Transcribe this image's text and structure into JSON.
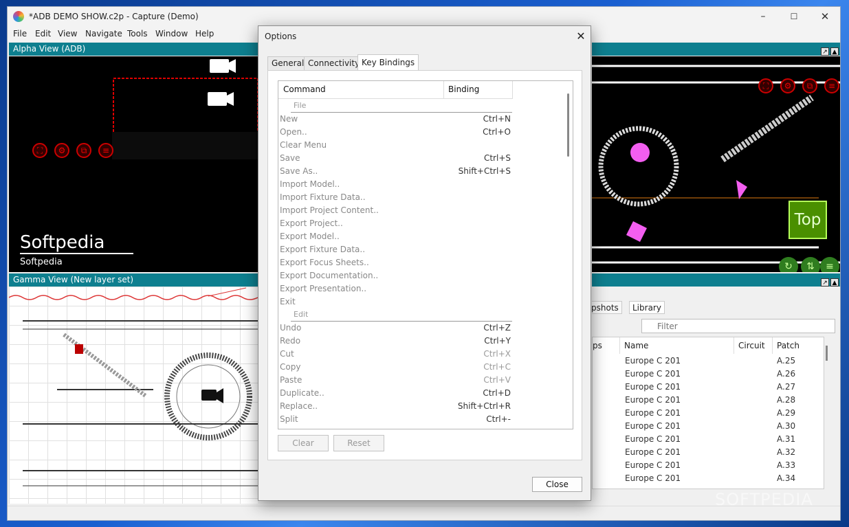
{
  "window": {
    "title": "*ADB DEMO SHOW.c2p - Capture (Demo)",
    "min": "–",
    "max": "☐",
    "close": "✕"
  },
  "menu": [
    "File",
    "Edit",
    "View",
    "Navigate",
    "Tools",
    "Window",
    "Help"
  ],
  "panels": {
    "alpha": {
      "title": "Alpha View  (ADB)",
      "caption_big": "Softpedia",
      "caption_small": "Softpedia"
    },
    "gamma": {
      "title": "Gamma View  (New layer set)"
    },
    "top": {
      "label": "Top"
    }
  },
  "library": {
    "tabs": [
      "pshots",
      "Library"
    ],
    "filter_placeholder": "Filter",
    "columns": [
      "ps",
      "Name",
      "Circuit",
      "Patch"
    ],
    "rows": [
      {
        "name": "Europe C 201",
        "patch": "A.25"
      },
      {
        "name": "Europe C 201",
        "patch": "A.26"
      },
      {
        "name": "Europe C 201",
        "patch": "A.27"
      },
      {
        "name": "Europe C 201",
        "patch": "A.28"
      },
      {
        "name": "Europe C 201",
        "patch": "A.29"
      },
      {
        "name": "Europe C 201",
        "patch": "A.30"
      },
      {
        "name": "Europe C 201",
        "patch": "A.31"
      },
      {
        "name": "Europe C 201",
        "patch": "A.32"
      },
      {
        "name": "Europe C 201",
        "patch": "A.33"
      },
      {
        "name": "Europe C 201",
        "patch": "A.34"
      }
    ]
  },
  "dialog": {
    "title": "Options",
    "close_x": "✕",
    "tabs": [
      "General",
      "Connectivity",
      "Key Bindings"
    ],
    "active_tab": "Key Bindings",
    "columns": {
      "command": "Command",
      "binding": "Binding"
    },
    "rows": [
      {
        "type": "group",
        "label": "File"
      },
      {
        "type": "cmd",
        "command": "New",
        "binding": "Ctrl+N"
      },
      {
        "type": "cmd",
        "command": "Open..",
        "binding": "Ctrl+O"
      },
      {
        "type": "cmd",
        "command": "Clear Menu",
        "binding": ""
      },
      {
        "type": "cmd",
        "command": "Save",
        "binding": "Ctrl+S"
      },
      {
        "type": "cmd",
        "command": "Save As..",
        "binding": "Shift+Ctrl+S"
      },
      {
        "type": "cmd",
        "command": "Import Model..",
        "binding": ""
      },
      {
        "type": "cmd",
        "command": "Import Fixture Data..",
        "binding": ""
      },
      {
        "type": "cmd",
        "command": "Import Project Content..",
        "binding": ""
      },
      {
        "type": "cmd",
        "command": "Export Project..",
        "binding": ""
      },
      {
        "type": "cmd",
        "command": "Export Model..",
        "binding": ""
      },
      {
        "type": "cmd",
        "command": "Export Fixture Data..",
        "binding": ""
      },
      {
        "type": "cmd",
        "command": "Export Focus Sheets..",
        "binding": ""
      },
      {
        "type": "cmd",
        "command": "Export Documentation..",
        "binding": ""
      },
      {
        "type": "cmd",
        "command": "Export Presentation..",
        "binding": ""
      },
      {
        "type": "cmd",
        "command": "Exit",
        "binding": ""
      },
      {
        "type": "group",
        "label": "Edit"
      },
      {
        "type": "cmd",
        "command": "Undo",
        "binding": "Ctrl+Z"
      },
      {
        "type": "cmd",
        "command": "Redo",
        "binding": "Ctrl+Y"
      },
      {
        "type": "cmd",
        "command": "Cut",
        "binding": "Ctrl+X",
        "dim": true
      },
      {
        "type": "cmd",
        "command": "Copy",
        "binding": "Ctrl+C",
        "dim": true
      },
      {
        "type": "cmd",
        "command": "Paste",
        "binding": "Ctrl+V",
        "dim": true
      },
      {
        "type": "cmd",
        "command": "Duplicate..",
        "binding": "Ctrl+D"
      },
      {
        "type": "cmd",
        "command": "Replace..",
        "binding": "Shift+Ctrl+R"
      },
      {
        "type": "cmd",
        "command": "Split",
        "binding": "Ctrl+-"
      }
    ],
    "clear_label": "Clear",
    "reset_label": "Reset",
    "close_label": "Close"
  },
  "watermark": "SOFTPEDIA",
  "colors": {
    "panel_header": "#0e7f8f",
    "accent_red": "#cc0000",
    "top_label": "#4a8f00"
  }
}
